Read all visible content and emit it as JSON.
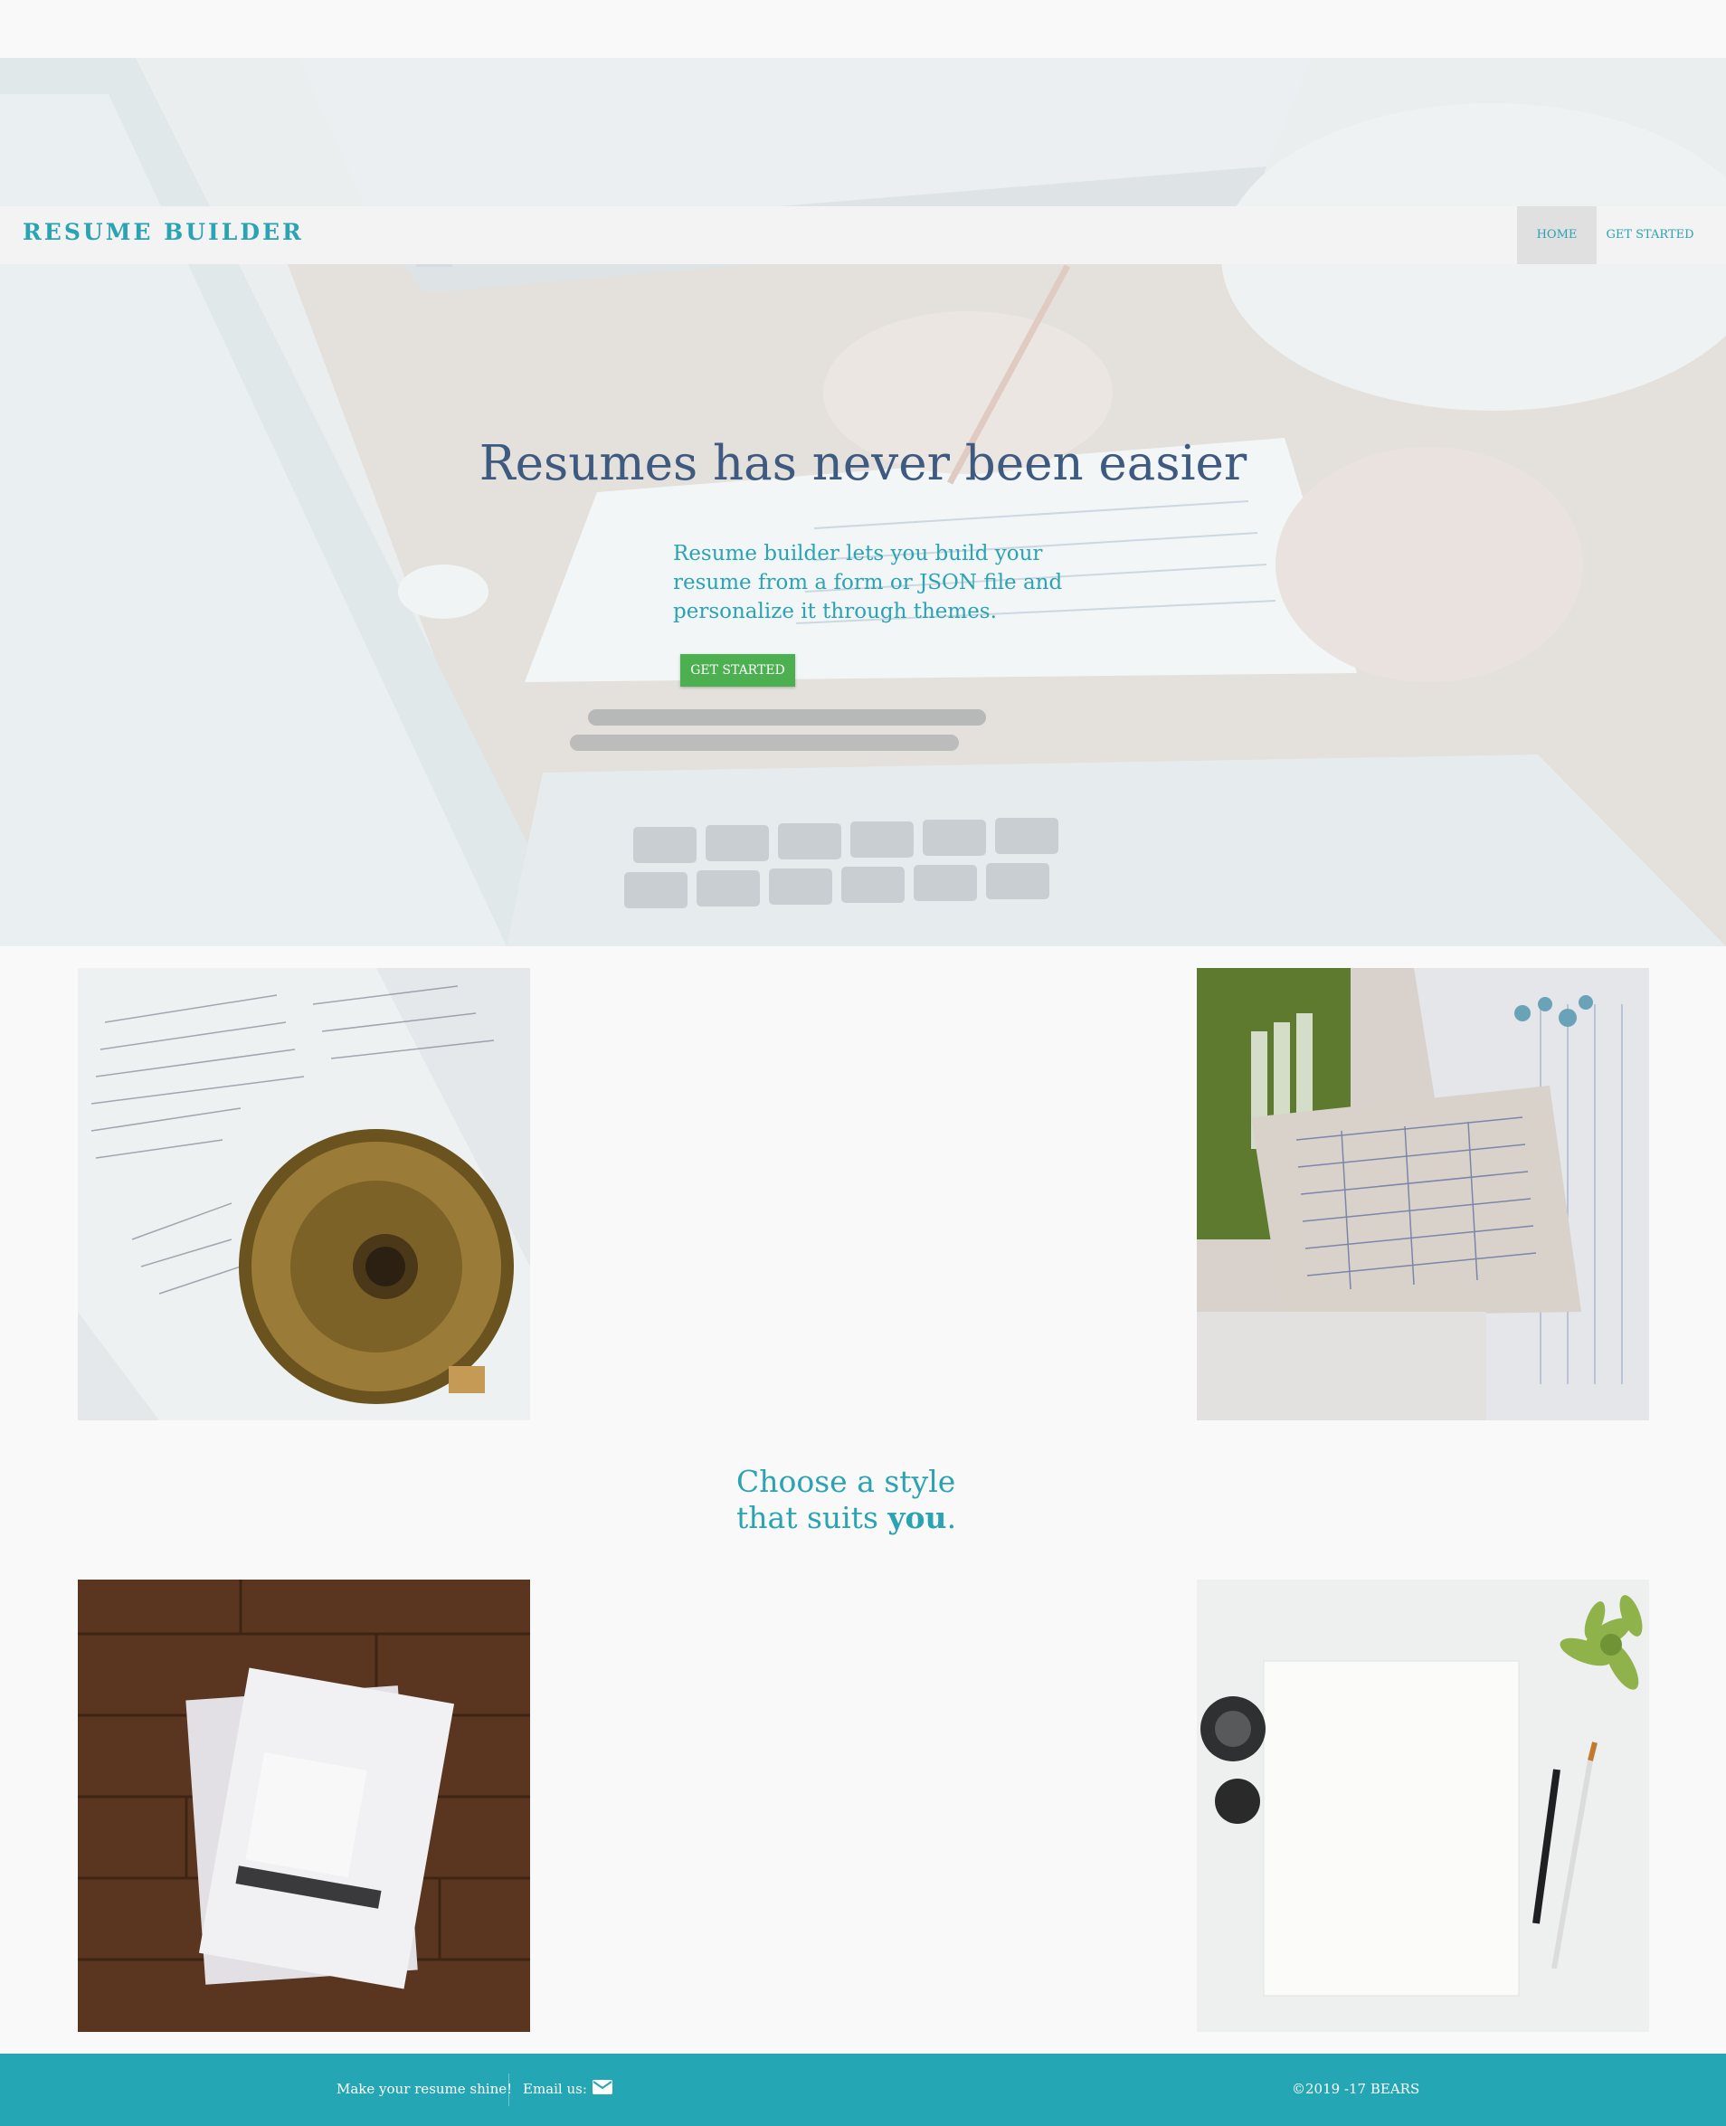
{
  "nav": {
    "brand": "RESUME BUILDER",
    "items": [
      {
        "label": "HOME",
        "active": true
      },
      {
        "label": "GET STARTED",
        "active": false
      }
    ]
  },
  "hero": {
    "title": "Resumes has never been easier",
    "description": "Resume builder lets you build your resume from a form or JSON file and personalize it through themes.",
    "button_label": "GET STARTED"
  },
  "gallery": {
    "tagline_line1": "Choose a style",
    "tagline_line2_prefix": "that suits ",
    "tagline_emphasis": "you",
    "tagline_suffix": "."
  },
  "footer": {
    "shine": "Make your resume shine!",
    "email_label": "Email us:",
    "email_icon": "envelope-icon",
    "copyright": "©2019 -17 BEARS"
  },
  "colors": {
    "accent": "#2aa3b3",
    "title": "#3e5a80",
    "button": "#4caf50",
    "footer": "#25a6b4"
  }
}
